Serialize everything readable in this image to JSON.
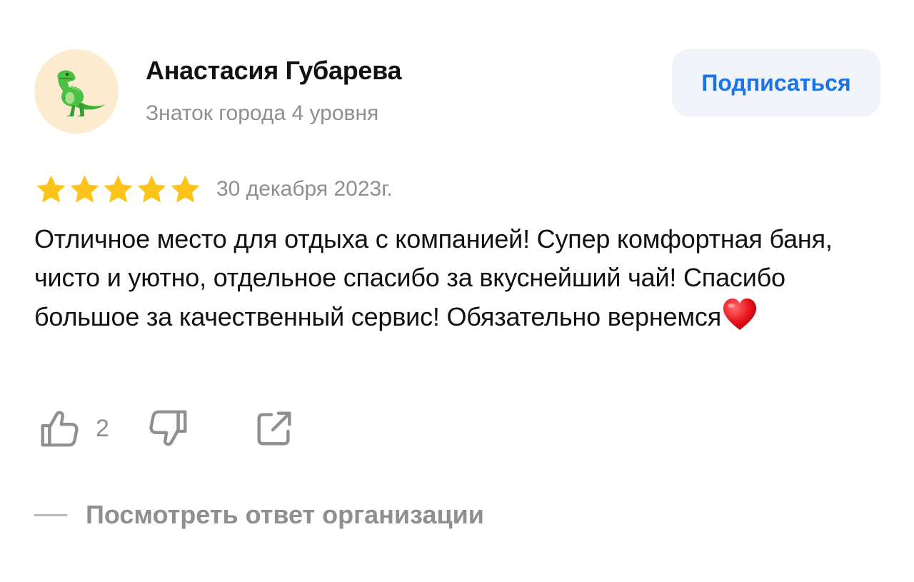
{
  "author": {
    "name": "Анастасия Губарева",
    "level": "Знаток города 4 уровня",
    "avatar_icon": "dinosaur-icon"
  },
  "subscribe_label": "Подписаться",
  "review": {
    "rating": 5,
    "rating_max": 5,
    "date": "30 декабря 2023г.",
    "text": "Отличное место для отдыха с компанией! Супер комфортная баня, чисто и уютно, отдельное спасибо за вкуснейший чай! Спасибо большое за качественный сервис! Обязательно вернемся",
    "trailing_emoji": "heart-icon"
  },
  "actions": {
    "like_icon": "thumbs-up-icon",
    "like_count": "2",
    "dislike_icon": "thumbs-down-icon",
    "share_icon": "share-icon"
  },
  "org_reply_label": "Посмотреть ответ организации",
  "colors": {
    "accent": "#1a73e8",
    "star": "#fcc419",
    "muted_text": "#8f8f8f",
    "button_bg": "#f0f4fa",
    "avatar_bg": "#fdebd0"
  }
}
